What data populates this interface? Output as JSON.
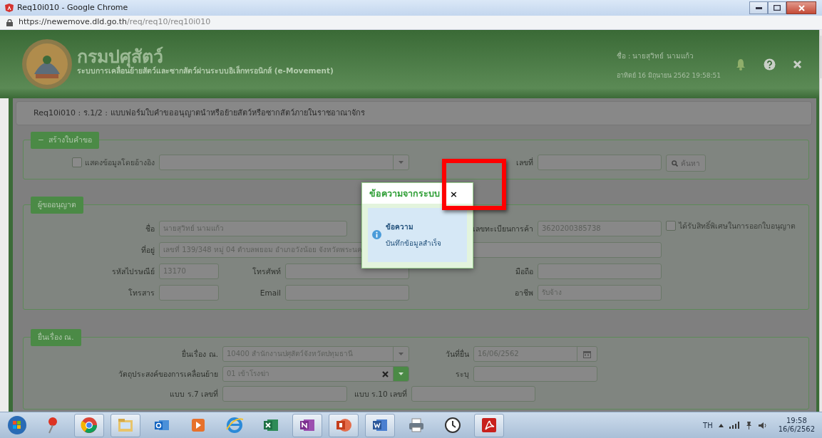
{
  "browser": {
    "title": "Req10i010 - Google Chrome",
    "url_host": "https://newemove.dld.go.th",
    "url_path": "/req/req10/req10i010"
  },
  "header": {
    "org_name": "กรมปศุสัตว์",
    "system_name": "ระบบการเคลื่อนย้ายสัตว์และซากสัตว์ผ่านระบบอิเล็กทรอนิกส์ (e-Movement)",
    "user": "ชื่อ :  นายสุวิทย์ นามแก้ว",
    "datetime": "อาทิตย์ 16 มิถุนายน 2562 19:58:51"
  },
  "page_title": "Req10i010 : ร.1/2 : แบบฟอร์มใบคำขออนุญาตนำหรือย้ายสัตว์หรือซากสัตว์ภายในราชอาณาจักร",
  "sections": [
    {
      "legend": "สร้างใบคำขอ",
      "toggle": "−",
      "rows": [
        [
          {
            "kind": "check",
            "label": "แสดงข้อมูลโดยอ้างอิง",
            "checked": false
          },
          {
            "kind": "select",
            "clearable": false
          },
          {
            "kind": "label",
            "text": "เลขที่"
          },
          {
            "kind": "input"
          },
          {
            "kind": "button",
            "text": "ค้นหา"
          }
        ]
      ]
    },
    {
      "legend": "ผู้ขออนุญาต",
      "rows": [
        [
          {
            "kind": "label",
            "text": "ชื่อ"
          },
          {
            "kind": "input",
            "value": "นายสุวิทย์  นามแก้ว"
          },
          {
            "kind": "blank"
          },
          {
            "kind": "blank"
          },
          {
            "kind": "label",
            "text": "เลขทะเบียนการค้า"
          },
          {
            "kind": "input",
            "value": "3620200385738"
          },
          {
            "kind": "check",
            "label": "ได้รับสิทธิ์พิเศษในการออกใบอนุญาต",
            "checked": false
          }
        ],
        [
          {
            "kind": "label",
            "text": "ที่อยู่"
          },
          {
            "kind": "input",
            "value": "เลขที่ 139/348  หมู่ 04  ตำบลพยอม อำเภอวังน้อย จังหวัดพระนค"
          }
        ],
        [
          {
            "kind": "label",
            "text": "รหัสไปรษณีย์"
          },
          {
            "kind": "input",
            "value": "13170"
          },
          {
            "kind": "label",
            "text": "โทรศัพท์"
          },
          {
            "kind": "input"
          },
          {
            "kind": "label",
            "text": "มือถือ"
          },
          {
            "kind": "input"
          }
        ],
        [
          {
            "kind": "label",
            "text": "โทรสาร"
          },
          {
            "kind": "input"
          },
          {
            "kind": "label",
            "text": "Email"
          },
          {
            "kind": "input"
          },
          {
            "kind": "label",
            "text": "อาชีพ"
          },
          {
            "kind": "input",
            "value": "รับจ้าง"
          }
        ]
      ]
    },
    {
      "legend": "ยื่นเรื่อง ณ.",
      "rows": [
        [
          {
            "kind": "label",
            "text": "ยื่นเรื่อง ณ."
          },
          {
            "kind": "select",
            "value": "10400 สำนักงานปศุสัตว์จังหวัดปทุมธานี",
            "clearable": false
          },
          {
            "kind": "label",
            "text": "วันที่ยื่น"
          },
          {
            "kind": "date",
            "value": "16/06/2562"
          }
        ],
        [
          {
            "kind": "label",
            "text": "วัตถุประสงค์ของการเคลื่อนย้าย"
          },
          {
            "kind": "select",
            "value": "01 เข้าโรงฆ่า",
            "clearable": true
          },
          {
            "kind": "label",
            "text": "ระบุ"
          },
          {
            "kind": "input"
          }
        ],
        [
          {
            "kind": "label",
            "text": "แบบ ร.7 เลขที่"
          },
          {
            "kind": "input"
          },
          {
            "kind": "label",
            "text": "แบบ ร.10 เลขที่"
          },
          {
            "kind": "input"
          }
        ]
      ]
    }
  ],
  "modal": {
    "title": "ข้อความจากระบบ",
    "close": "×",
    "heading": "ข้อความ",
    "message": "บันทึกข้อมูลสำเร็จ"
  },
  "tray": {
    "language": "TH",
    "time": "19:58",
    "date": "16/6/2562"
  }
}
